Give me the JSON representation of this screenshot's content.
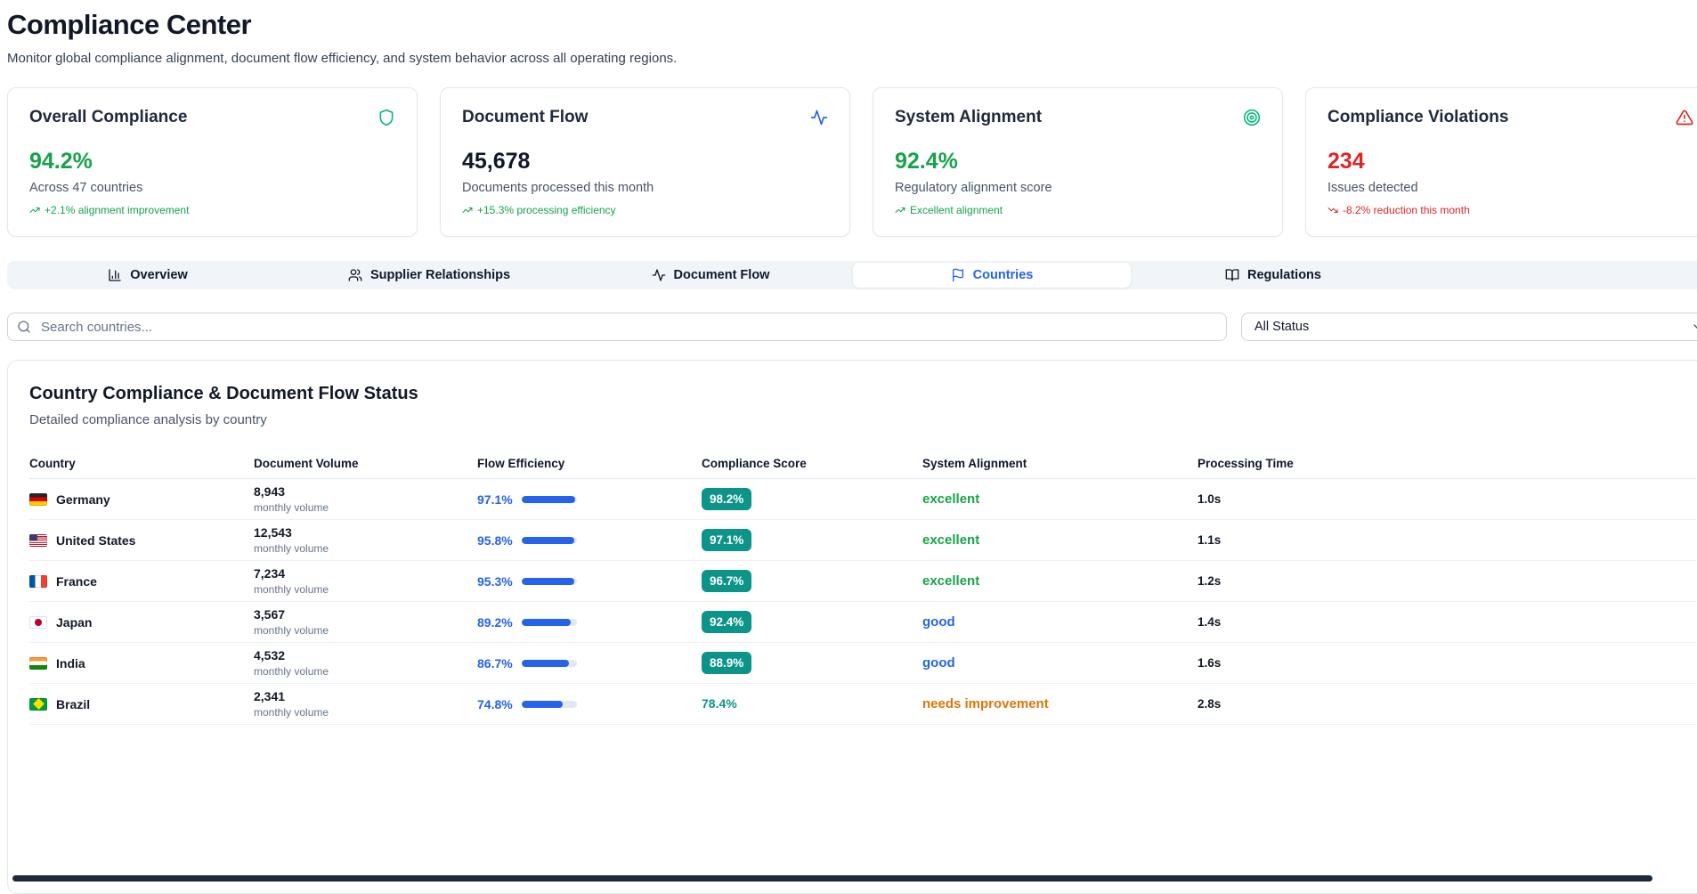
{
  "page": {
    "title": "Compliance Center",
    "subtitle": "Monitor global compliance alignment, document flow efficiency, and system behavior across all operating regions."
  },
  "stats": [
    {
      "title": "Overall Compliance",
      "icon": "shield-icon",
      "icon_color": "#10b981",
      "value": "94.2%",
      "value_color": "#16a34a",
      "caption": "Across 47 countries",
      "trend": "+2.1% alignment improvement",
      "trend_dir": "up",
      "trend_color": "#16a34a"
    },
    {
      "title": "Document Flow",
      "icon": "activity-icon",
      "icon_color": "#2563eb",
      "value": "45,678",
      "value_color": "#0f172a",
      "caption": "Documents processed this month",
      "trend": "+15.3% processing efficiency",
      "trend_dir": "up",
      "trend_color": "#16a34a"
    },
    {
      "title": "System Alignment",
      "icon": "target-icon",
      "icon_color": "#10b981",
      "value": "92.4%",
      "value_color": "#16a34a",
      "caption": "Regulatory alignment score",
      "trend": "Excellent alignment",
      "trend_dir": "up",
      "trend_color": "#16a34a"
    },
    {
      "title": "Compliance Violations",
      "icon": "alert-triangle-icon",
      "icon_color": "#dc2626",
      "value": "234",
      "value_color": "#dc2626",
      "caption": "Issues detected",
      "trend": "-8.2% reduction this month",
      "trend_dir": "down",
      "trend_color": "#dc2626"
    }
  ],
  "tabs": [
    {
      "label": "Overview",
      "icon": "bar-chart-icon",
      "active": false
    },
    {
      "label": "Supplier Relationships",
      "icon": "users-icon",
      "active": false
    },
    {
      "label": "Document Flow",
      "icon": "activity-icon",
      "active": false
    },
    {
      "label": "Countries",
      "icon": "flag-icon",
      "active": true
    },
    {
      "label": "Regulations",
      "icon": "book-open-icon",
      "active": false
    }
  ],
  "filter": {
    "search_placeholder": "Search countries...",
    "status_filter": "All Status"
  },
  "panel": {
    "title": "Country Compliance & Document Flow Status",
    "subtitle": "Detailed compliance analysis by country",
    "columns": [
      "Country",
      "Document Volume",
      "Flow Efficiency",
      "Compliance Score",
      "System Alignment",
      "Processing Time"
    ],
    "rows": [
      {
        "country": "Germany",
        "flag": "de",
        "volume": "8,943",
        "volume_caption": "monthly volume",
        "flow_pct": "97.1%",
        "flow_value": 97.1,
        "score": "98.2%",
        "score_badge": true,
        "alignment": "excellent",
        "alignment_color": "#16a34a",
        "time": "1.0s"
      },
      {
        "country": "United States",
        "flag": "us",
        "volume": "12,543",
        "volume_caption": "monthly volume",
        "flow_pct": "95.8%",
        "flow_value": 95.8,
        "score": "97.1%",
        "score_badge": true,
        "alignment": "excellent",
        "alignment_color": "#16a34a",
        "time": "1.1s"
      },
      {
        "country": "France",
        "flag": "fr",
        "volume": "7,234",
        "volume_caption": "monthly volume",
        "flow_pct": "95.3%",
        "flow_value": 95.3,
        "score": "96.7%",
        "score_badge": true,
        "alignment": "excellent",
        "alignment_color": "#16a34a",
        "time": "1.2s"
      },
      {
        "country": "Japan",
        "flag": "jp",
        "volume": "3,567",
        "volume_caption": "monthly volume",
        "flow_pct": "89.2%",
        "flow_value": 89.2,
        "score": "92.4%",
        "score_badge": true,
        "alignment": "good",
        "alignment_color": "#2563eb",
        "time": "1.4s"
      },
      {
        "country": "India",
        "flag": "in",
        "volume": "4,532",
        "volume_caption": "monthly volume",
        "flow_pct": "86.7%",
        "flow_value": 86.7,
        "score": "88.9%",
        "score_badge": true,
        "alignment": "good",
        "alignment_color": "#2563eb",
        "time": "1.6s"
      },
      {
        "country": "Brazil",
        "flag": "br",
        "volume": "2,341",
        "volume_caption": "monthly volume",
        "flow_pct": "74.8%",
        "flow_value": 74.8,
        "score": "78.4%",
        "score_badge": false,
        "alignment": "needs improvement",
        "alignment_color": "#d97706",
        "time": "2.8s"
      }
    ]
  },
  "colors": {
    "accent_blue": "#2563eb",
    "badge_teal": "#0d9488",
    "green": "#16a34a",
    "red": "#dc2626",
    "amber": "#d97706"
  }
}
